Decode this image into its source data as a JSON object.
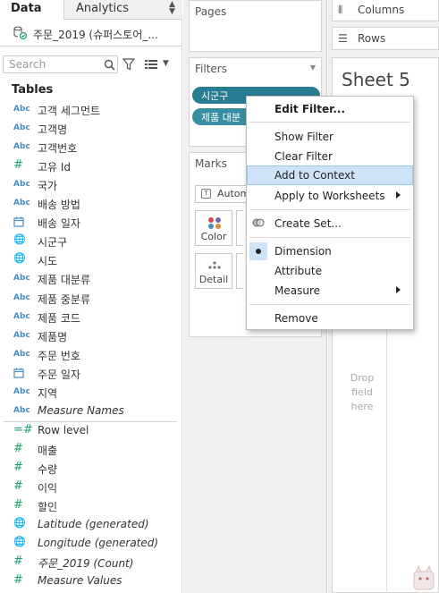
{
  "tabs": {
    "data": "Data",
    "analytics": "Analytics"
  },
  "datasource": {
    "name": "주문_2019 (슈퍼스토어_..."
  },
  "search": {
    "placeholder": "Search"
  },
  "tables_heading": "Tables",
  "fields": [
    {
      "icon": "Abc",
      "name": "고객 세그먼트"
    },
    {
      "icon": "Abc",
      "name": "고객명"
    },
    {
      "icon": "Abc",
      "name": "고객번호"
    },
    {
      "icon": "#",
      "name": "고유 Id"
    },
    {
      "icon": "Abc",
      "name": "국가"
    },
    {
      "icon": "Abc",
      "name": "배송 방법"
    },
    {
      "icon": "calendar",
      "name": "배송 일자"
    },
    {
      "icon": "globe",
      "name": "시군구"
    },
    {
      "icon": "globe",
      "name": "시도"
    },
    {
      "icon": "Abc",
      "name": "제품 대분류"
    },
    {
      "icon": "Abc",
      "name": "제품 중분류"
    },
    {
      "icon": "Abc",
      "name": "제품 코드"
    },
    {
      "icon": "Abc",
      "name": "제품명"
    },
    {
      "icon": "Abc",
      "name": "주문 번호"
    },
    {
      "icon": "calendar",
      "name": "주문 일자"
    },
    {
      "icon": "Abc",
      "name": "지역"
    },
    {
      "icon": "Abc",
      "name": "Measure Names"
    },
    {
      "icon": "=#",
      "name": "Row level"
    },
    {
      "icon": "#",
      "name": "매출"
    },
    {
      "icon": "#",
      "name": "수량"
    },
    {
      "icon": "#",
      "name": "이익"
    },
    {
      "icon": "#",
      "name": "할인"
    },
    {
      "icon": "globe",
      "name": "Latitude (generated)"
    },
    {
      "icon": "globe",
      "name": "Longitude (generated)"
    },
    {
      "icon": "#",
      "name": "주문_2019 (Count)"
    },
    {
      "icon": "#",
      "name": "Measure Values"
    }
  ],
  "cards": {
    "pages": "Pages",
    "filters": "Filters",
    "filter_pills": [
      "시군구",
      "제품 대분"
    ],
    "marks": "Marks",
    "mark_type": "Automatic",
    "color": "Color",
    "detail": "Detail"
  },
  "shelves": {
    "columns": "Columns",
    "rows": "Rows"
  },
  "sheet": {
    "title": "Sheet 5",
    "drop_hint": "Drop field here"
  },
  "context_menu": {
    "edit_filter": "Edit Filter...",
    "show_filter": "Show Filter",
    "clear_filter": "Clear Filter",
    "add_to_context": "Add to Context",
    "apply_to_worksheets": "Apply to Worksheets",
    "create_set": "Create Set...",
    "dimension": "Dimension",
    "attribute": "Attribute",
    "measure": "Measure",
    "remove": "Remove"
  },
  "colors": {
    "pill": "#3a8ea3",
    "highlight": "#cde3f7",
    "dimension_icon": "#4a8bc2",
    "measure_icon": "#20a06a"
  }
}
